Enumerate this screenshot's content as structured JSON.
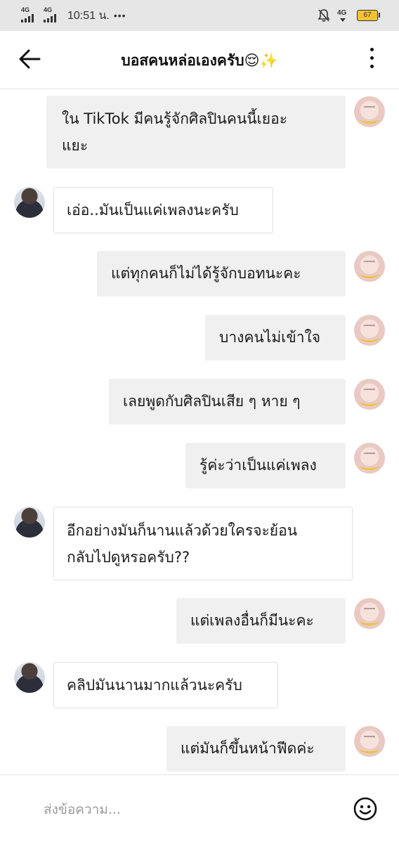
{
  "status_bar": {
    "signal_1_label": "4G",
    "signal_2_label": "4G",
    "time": "10:51 น.",
    "more": "•••",
    "network_label": "4G",
    "battery": "67"
  },
  "header": {
    "title": "บอสคนหล่อเองครับ😌✨",
    "back_icon": "arrow-left-icon",
    "menu_icon": "more-vertical-icon"
  },
  "messages": [
    {
      "sender": "me",
      "lines": [
        "ใน TikTok มีคนรู้จักศิลปินคนนี้เยอะ",
        "แยะ"
      ]
    },
    {
      "sender": "them",
      "lines": [
        "เอ่อ..มันเป็นแค่เพลงนะครับ"
      ]
    },
    {
      "sender": "me",
      "lines": [
        "แต่ทุกคนก็ไม่ได้รู้จักบอทนะคะ"
      ]
    },
    {
      "sender": "me",
      "lines": [
        "บางคนไม่เข้าใจ"
      ]
    },
    {
      "sender": "me",
      "lines": [
        "เลยพูดกับศิลปินเสีย ๆ หาย ๆ"
      ]
    },
    {
      "sender": "me",
      "lines": [
        "รู้ค่ะว่าเป็นแค่เพลง"
      ]
    },
    {
      "sender": "them",
      "lines": [
        "อีกอย่างมันก็นานแล้วด้วยใครจะย้อน",
        "กลับไปดูหรอครับ??"
      ]
    },
    {
      "sender": "me",
      "lines": [
        "แต่เพลงอื่นก็มีนะคะ"
      ]
    },
    {
      "sender": "them",
      "lines": [
        "คลิปมันนานมากแล้วนะครับ"
      ]
    },
    {
      "sender": "me",
      "lines": [
        "แต่มันก็ขึ้นหน้าฟีดค่ะ"
      ]
    }
  ],
  "input": {
    "placeholder": "ส่งข้อความ...",
    "emoji_icon": "smiley-icon"
  },
  "colors": {
    "my_bubble": "#f0f0f0",
    "their_bubble": "#ffffff",
    "status_bar": "#e6e6e6",
    "battery": "#f2c230"
  }
}
